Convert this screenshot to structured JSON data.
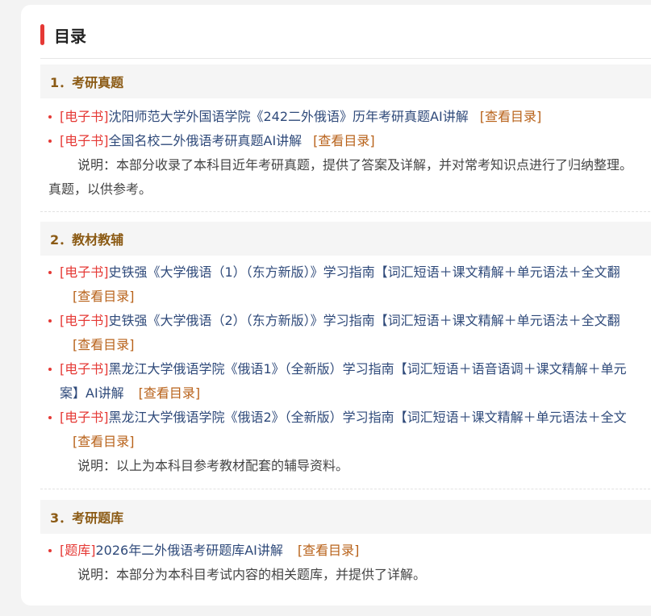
{
  "page": {
    "title": "目录"
  },
  "sections": [
    {
      "heading": "1．考研真题",
      "items": [
        {
          "tag": "[电子书]",
          "title": "沈阳师范大学外国语学院《242二外俄语》历年考研真题AI讲解",
          "link": "[查看目录]"
        },
        {
          "tag": "[电子书]",
          "title": "全国名校二外俄语考研真题AI讲解",
          "link": "[查看目录]"
        }
      ],
      "note_line1": "说明：本部分收录了本科目近年考研真题，提供了答案及详解，并对常考知识点进行了归纳整理。",
      "note_line2": "真题，以供参考。"
    },
    {
      "heading": "2．教材教辅",
      "items": [
        {
          "tag": "[电子书]",
          "title": "史铁强《大学俄语（1）（东方新版）》学习指南【词汇短语＋课文精解＋单元语法＋全文翻",
          "cont": "",
          "link": "[查看目录]"
        },
        {
          "tag": "[电子书]",
          "title": "史铁强《大学俄语（2）（东方新版）》学习指南【词汇短语＋课文精解＋单元语法＋全文翻",
          "cont": "",
          "link": "[查看目录]"
        },
        {
          "tag": "[电子书]",
          "title": "黑龙江大学俄语学院《俄语1》（全新版）学习指南【词汇短语＋语音语调＋课文精解＋单元",
          "cont": "案】AI讲解",
          "link": "[查看目录]"
        },
        {
          "tag": "[电子书]",
          "title": "黑龙江大学俄语学院《俄语2》（全新版）学习指南【词汇短语＋课文精解＋单元语法＋全文",
          "cont": "",
          "link": "[查看目录]"
        }
      ],
      "note": "说明：以上为本科目参考教材配套的辅导资料。"
    },
    {
      "heading": "3．考研题库",
      "items": [
        {
          "tag": "[题库]",
          "title": "2026年二外俄语考研题库AI讲解",
          "link": "[查看目录]"
        }
      ],
      "note": "说明：本部分为本科目考试内容的相关题库，并提供了详解。"
    }
  ]
}
